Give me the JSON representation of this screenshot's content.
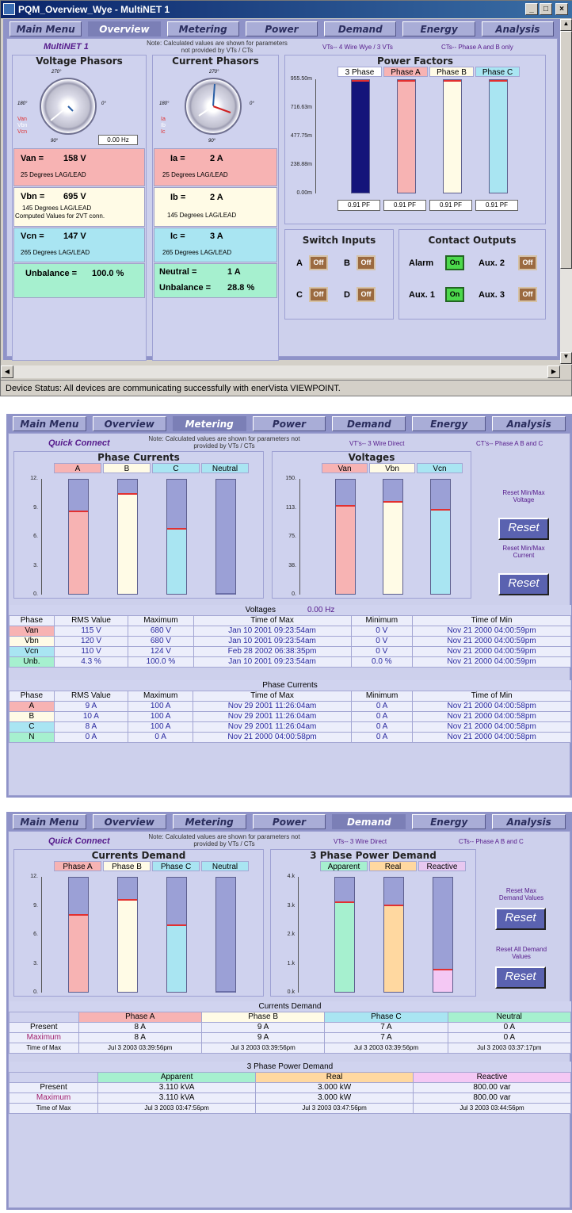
{
  "window": {
    "title": "PQM_Overview_Wye - MultiNET 1",
    "min_label": "_",
    "max_label": "□",
    "close_label": "×",
    "status": "Device Status:  All devices are communicating successfully with enerVista VIEWPOINT."
  },
  "nav": {
    "items": [
      "Main Menu",
      "Overview",
      "Metering",
      "Power",
      "Demand",
      "Energy",
      "Analysis"
    ]
  },
  "overview": {
    "device": "MultiNET 1",
    "note": "Note: Calculated values are shown for parameters not provided by VTs / CTs",
    "vts": "VTs-- 4 Wire Wye / 3 VTs",
    "cts": "CTs-- Phase A and B only",
    "voltage_phasors": {
      "title": "Voltage Phasors",
      "deg270": "270°",
      "deg180": "180°",
      "deg0": "0°",
      "deg90": "90°",
      "freq": "0.00 Hz",
      "legend": [
        "Van",
        "Vbn",
        "Vcn"
      ]
    },
    "current_phasors": {
      "title": "Current Phasors",
      "deg270": "270°",
      "deg180": "180°",
      "deg0": "0°",
      "deg90": "90°",
      "legend": [
        "Ia",
        "Ib",
        "Ic"
      ]
    },
    "van": {
      "label": "Van =",
      "value": "158 V",
      "sub": "25 Degrees LAG/LEAD"
    },
    "vbn": {
      "label": "Vbn =",
      "value": "695 V",
      "sub1": "145 Degrees LAG/LEAD",
      "sub2": "Computed Values for 2VT conn."
    },
    "vcn": {
      "label": "Vcn =",
      "value": "147 V",
      "sub": "265 Degrees LAG/LEAD"
    },
    "v_unbalance": {
      "label": "Unbalance =",
      "value": "100.0 %"
    },
    "ia": {
      "label": "Ia =",
      "value": "2 A",
      "sub": "25 Degrees LAG/LEAD"
    },
    "ib": {
      "label": "Ib =",
      "value": "2 A",
      "sub": "145 Degrees LAG/LEAD"
    },
    "ic": {
      "label": "Ic =",
      "value": "3 A",
      "sub": "265 Degrees LAG/LEAD"
    },
    "neutral": {
      "label": "Neutral =",
      "value": "1 A"
    },
    "i_unbalance": {
      "label": "Unbalance =",
      "value": "28.8 %"
    },
    "power_factors": {
      "title": "Power Factors",
      "cols": [
        "3 Phase",
        "Phase A",
        "Phase B",
        "Phase C"
      ],
      "ticks": [
        "955.50m",
        "716.63m",
        "477.75m",
        "238.88m",
        "0.00m"
      ],
      "values": [
        "0.91 PF",
        "0.91 PF",
        "0.91 PF",
        "0.91 PF"
      ],
      "fill": [
        0.985,
        0.985,
        0.985,
        0.985
      ]
    },
    "switch_inputs": {
      "title": "Switch Inputs",
      "items": [
        {
          "k": "A",
          "v": "Off"
        },
        {
          "k": "B",
          "v": "Off"
        },
        {
          "k": "C",
          "v": "Off"
        },
        {
          "k": "D",
          "v": "Off"
        }
      ]
    },
    "contact_outputs": {
      "title": "Contact Outputs",
      "items": [
        {
          "k": "Alarm",
          "v": "On"
        },
        {
          "k": "Aux. 2",
          "v": "Off"
        },
        {
          "k": "Aux. 1",
          "v": "On"
        },
        {
          "k": "Aux. 3",
          "v": "Off"
        }
      ]
    }
  },
  "metering": {
    "device": "Quick Connect",
    "note": "Note: Calculated values are shown for parameters not provided by VTs / CTs",
    "vts": "VT's--   3 Wire Direct",
    "cts": "CT's-- Phase A B and C",
    "phase_currents": {
      "title": "Phase Currents",
      "cols": [
        "A",
        "B",
        "C",
        "Neutral"
      ],
      "ticks": [
        "12.",
        "9.",
        "6.",
        "3.",
        "0."
      ],
      "fill": [
        0.72,
        0.87,
        0.57,
        0.0
      ]
    },
    "voltages_chart": {
      "title": "Voltages",
      "cols": [
        "Van",
        "Vbn",
        "Vcn"
      ],
      "ticks": [
        "150.",
        "113.",
        "75.",
        "38.",
        "0."
      ],
      "fill": [
        0.77,
        0.8,
        0.73
      ]
    },
    "reset_voltage": {
      "label": "Reset Min/Max Voltage",
      "btn": "Reset"
    },
    "reset_current": {
      "label": "Reset Min/Max Current",
      "btn": "Reset"
    },
    "vtable": {
      "title": "Voltages",
      "freq": "0.00 Hz",
      "headers": [
        "Phase",
        "RMS Value",
        "Maximum",
        "Time of Max",
        "Minimum",
        "Time of Min"
      ],
      "rows": [
        [
          "Van",
          "115 V",
          "680 V",
          "Jan 10 2001 09:23:54am",
          "0 V",
          "Nov 21 2000 04:00:59pm"
        ],
        [
          "Vbn",
          "120 V",
          "680 V",
          "Jan 10 2001 09:23:54am",
          "0 V",
          "Nov 21 2000 04:00:59pm"
        ],
        [
          "Vcn",
          "110 V",
          "124 V",
          "Feb 28 2002 06:38:35pm",
          "0 V",
          "Nov 21 2000 04:00:59pm"
        ],
        [
          "Unb.",
          "4.3 %",
          "100.0 %",
          "Jan 10 2001 09:23:54am",
          "0.0 %",
          "Nov 21 2000 04:00:59pm"
        ]
      ]
    },
    "ctable": {
      "title": "Phase Currents",
      "headers": [
        "Phase",
        "RMS Value",
        "Maximum",
        "Time of Max",
        "Minimum",
        "Time of Min"
      ],
      "rows": [
        [
          "A",
          "9 A",
          "100 A",
          "Nov 29 2001 11:26:04am",
          "0 A",
          "Nov 21 2000 04:00:58pm"
        ],
        [
          "B",
          "10 A",
          "100 A",
          "Nov 29 2001 11:26:04am",
          "0 A",
          "Nov 21 2000 04:00:58pm"
        ],
        [
          "C",
          "8 A",
          "100 A",
          "Nov 29 2001 11:26:04am",
          "0 A",
          "Nov 21 2000 04:00:58pm"
        ],
        [
          "N",
          "0 A",
          "0 A",
          "Nov 21 2000 04:00:58pm",
          "0 A",
          "Nov 21 2000 04:00:58pm"
        ]
      ]
    }
  },
  "demand": {
    "device": "Quick Connect",
    "note": "Note: Calculated values are shown for parameters not provided by VTs / CTs",
    "vts": "VTs--   3 Wire Direct",
    "cts": "CTs-- Phase A B and C",
    "currents_demand": {
      "title": "Currents Demand",
      "cols": [
        "Phase A",
        "Phase B",
        "Phase C",
        "Neutral"
      ],
      "ticks": [
        "12.",
        "9.",
        "6.",
        "3.",
        "0."
      ],
      "fill": [
        0.67,
        0.8,
        0.58,
        0.0
      ]
    },
    "power_demand": {
      "title": "3 Phase Power Demand",
      "cols": [
        "Apparent",
        "Real",
        "Reactive"
      ],
      "ticks": [
        "4.k",
        "3.k",
        "2.k",
        "1.k",
        "0.k"
      ],
      "fill": [
        0.78,
        0.75,
        0.2
      ]
    },
    "reset_max": {
      "label": "Reset Max Demand Values",
      "btn": "Reset"
    },
    "reset_all": {
      "label": "Reset All Demand Values",
      "btn": "Reset"
    },
    "ctable": {
      "title": "Currents Demand",
      "headers": [
        "",
        "Phase A",
        "Phase B",
        "Phase C",
        "Neutral"
      ],
      "rows": [
        [
          "Present",
          "8 A",
          "9 A",
          "7 A",
          "0 A"
        ],
        [
          "Maximum",
          "8 A",
          "9 A",
          "7 A",
          "0 A"
        ],
        [
          "Time of Max",
          "Jul 3 2003 03:39:56pm",
          "Jul 3 2003 03:39:56pm",
          "Jul 3 2003 03:39:56pm",
          "Jul 3 2003 03:37:17pm"
        ]
      ]
    },
    "ptable": {
      "title": "3 Phase Power Demand",
      "headers": [
        "",
        "Apparent",
        "Real",
        "Reactive"
      ],
      "rows": [
        [
          "Present",
          "3.110 kVA",
          "3.000 kW",
          "800.00 var"
        ],
        [
          "Maximum",
          "3.110 kVA",
          "3.000 kW",
          "800.00 var"
        ],
        [
          "Time of Max",
          "Jul 3 2003 03:47:56pm",
          "Jul 3 2003 03:47:56pm",
          "Jul 3 2003 03:44:56pm"
        ]
      ]
    }
  }
}
